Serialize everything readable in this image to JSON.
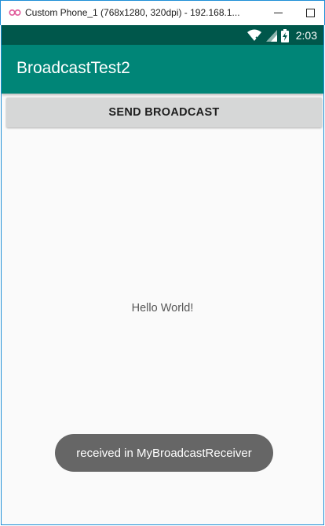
{
  "window": {
    "title": "Custom Phone_1 (768x1280, 320dpi) - 192.168.1...",
    "logo_icon": "infinity-logo-icon",
    "minimize_icon": "minimize-icon",
    "maximize_icon": "maximize-icon",
    "border_color": "#1f8fd6"
  },
  "status_bar": {
    "time": "2:03",
    "icons": [
      "wifi-icon",
      "signal-icon",
      "battery-charging-icon"
    ],
    "color": "#00574b"
  },
  "app_bar": {
    "title": "BroadcastTest2",
    "color": "#008577"
  },
  "main": {
    "send_button_label": "SEND BROADCAST",
    "hello_text": "Hello World!"
  },
  "toast": {
    "message": "received in MyBroadcastReceiver"
  }
}
